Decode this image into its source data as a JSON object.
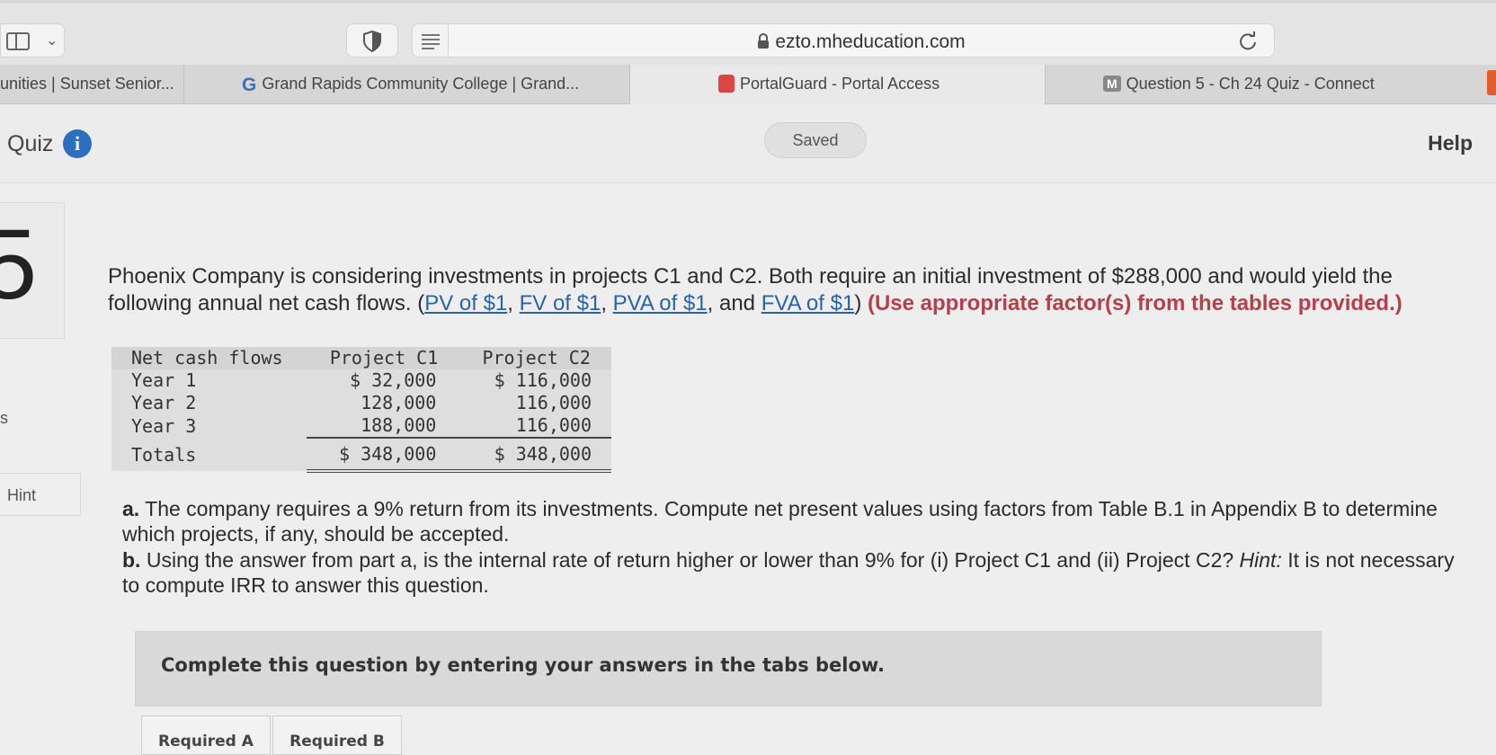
{
  "browser": {
    "url": "ezto.mheducation.com",
    "tabs": [
      {
        "label": "unities | Sunset Senior...",
        "favicon": "none"
      },
      {
        "label": "Grand Rapids Community College | Grand...",
        "favicon": "google-g-icon"
      },
      {
        "label": "PortalGuard - Portal Access",
        "favicon": "portalguard-icon"
      },
      {
        "label": "Question 5 - Ch 24 Quiz - Connect",
        "favicon": "mcgraw-m-icon"
      }
    ]
  },
  "header": {
    "title": "Quiz",
    "info_icon_glyph": "i",
    "saved_label": "Saved",
    "help_label": "Help"
  },
  "rail": {
    "question_number": "5",
    "side_letter": "s",
    "hint_label": "Hint"
  },
  "question": {
    "intro": "Phoenix Company is considering investments in projects C1 and C2. Both require an initial investment of $288,000 and would yield the following annual net cash flows. (",
    "links": [
      "PV of $1",
      "FV of $1",
      "PVA of $1",
      "FVA of $1"
    ],
    "sep1": ", ",
    "sep2": ", ",
    "sep3": ", and ",
    "close_paren": ") ",
    "emphasis": "(Use appropriate factor(s) from the tables provided.)"
  },
  "table": {
    "headers": [
      "Net cash flows",
      "Project C1",
      "Project C2"
    ],
    "rows": [
      {
        "label": "Year 1",
        "c1": "$ 32,000",
        "c2": "$ 116,000"
      },
      {
        "label": "Year 2",
        "c1": "128,000",
        "c2": "116,000"
      },
      {
        "label": "Year 3",
        "c1": "188,000",
        "c2": "116,000"
      }
    ],
    "totals": {
      "label": "Totals",
      "c1": "$ 348,000",
      "c2": "$ 348,000"
    }
  },
  "parts": {
    "a_label": "a.",
    "a_text": " The company requires a 9% return from its investments. Compute net present values using factors from Table B.1 in Appendix B to determine which projects, if any, should be accepted.",
    "b_label": "b.",
    "b_text": " Using the answer from part a, is the internal rate of return higher or lower than 9% for (i) Project C1 and (ii) Project C2? ",
    "b_hint_label": "Hint:",
    "b_hint_text": " It is not necessary to compute IRR to answer this question."
  },
  "instructions": {
    "text": "Complete this question by entering your answers in the tabs below.",
    "tabs": [
      "Required A",
      "Required B"
    ]
  },
  "colors": {
    "link": "#2a62a8",
    "emphasis": "#b6404a",
    "info": "#2d6fbf"
  }
}
